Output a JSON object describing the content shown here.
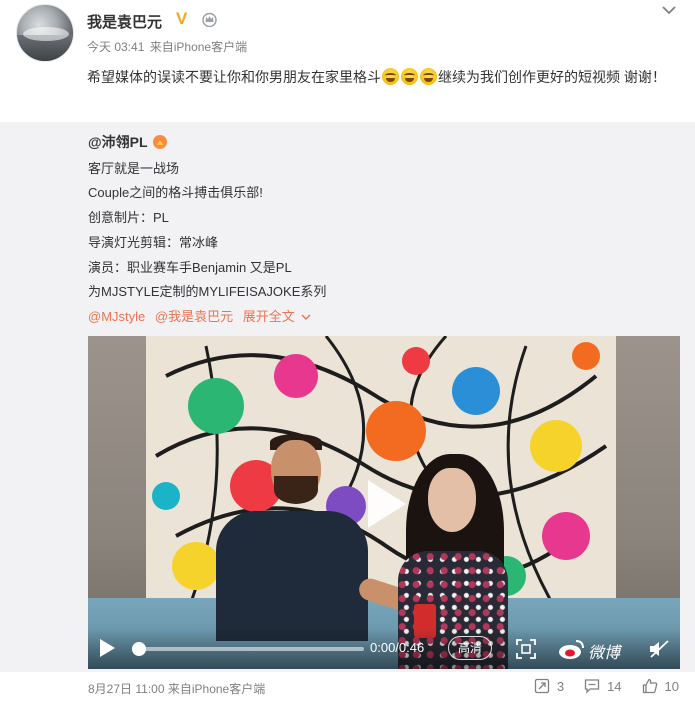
{
  "post": {
    "author": "我是袁巴元",
    "verified_badge": "V",
    "timestamp": "今天 03:41",
    "source": "来自iPhone客户端",
    "text_before_emoji": "希望媒体的误读不要让你和你男朋友在家里格斗",
    "emoji_name": "laughing-tears-emoji",
    "text_after_emoji": "继续为我们创作更好的短视频 谢谢！"
  },
  "repost": {
    "author": "@沛翎PL",
    "lines": [
      "客厅就是一战场",
      "Couple之间的格斗搏击俱乐部!",
      "创意制片：PL",
      "导演灯光剪辑：常冰峰",
      "演员：职业赛车手Benjamin 又是PL",
      "为MJSTYLE定制的MYLIFEISAJOKE系列"
    ],
    "mention_1": "@MJstyle",
    "mention_2": "@我是袁巴元",
    "expand_label": "展开全文"
  },
  "video": {
    "time_display": "0:00/0:46",
    "quality_label": "高清",
    "watermark": "微博",
    "progress_fraction": 0.0
  },
  "footer": {
    "date": "8月27日 11:00",
    "source": "来自iPhone客户端",
    "reposts": "3",
    "comments": "14",
    "likes": "10"
  },
  "colors": {
    "link": "#eb7350",
    "muted": "#808080",
    "repost_bg": "#f2f2f5",
    "verified": "#f5a623"
  },
  "icons": [
    "crown-icon",
    "chevron-down-icon",
    "play-icon",
    "fullscreen-icon",
    "weibo-logo-icon",
    "mute-icon",
    "repost-icon",
    "comment-icon",
    "like-icon"
  ]
}
